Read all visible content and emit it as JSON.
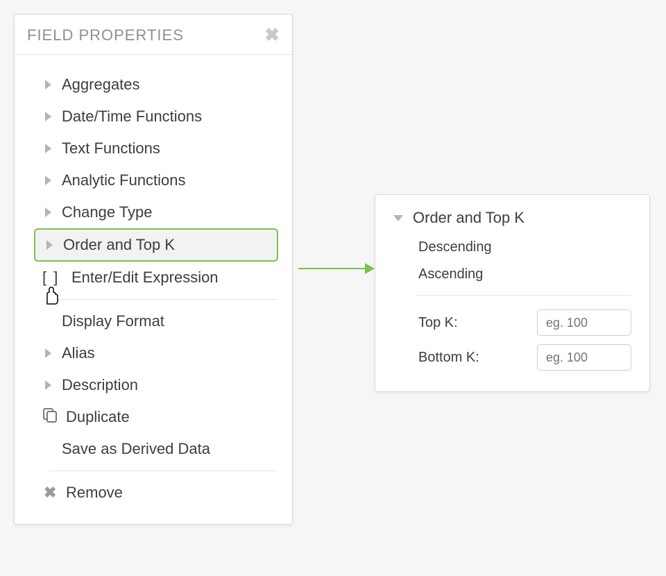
{
  "panel": {
    "title": "FIELD PROPERTIES",
    "items": {
      "aggregates": "Aggregates",
      "datetime": "Date/Time Functions",
      "text": "Text Functions",
      "analytic": "Analytic Functions",
      "changeType": "Change Type",
      "orderTopK": "Order and Top K",
      "expression": "Enter/Edit Expression",
      "displayFormat": "Display Format",
      "alias": "Alias",
      "description": "Description",
      "duplicate": "Duplicate",
      "saveDerived": "Save as Derived Data",
      "remove": "Remove"
    }
  },
  "callout": {
    "title": "Order and Top K",
    "descending": "Descending",
    "ascending": "Ascending",
    "topk_label": "Top K:",
    "bottomk_label": "Bottom K:",
    "placeholder": "eg. 100"
  }
}
